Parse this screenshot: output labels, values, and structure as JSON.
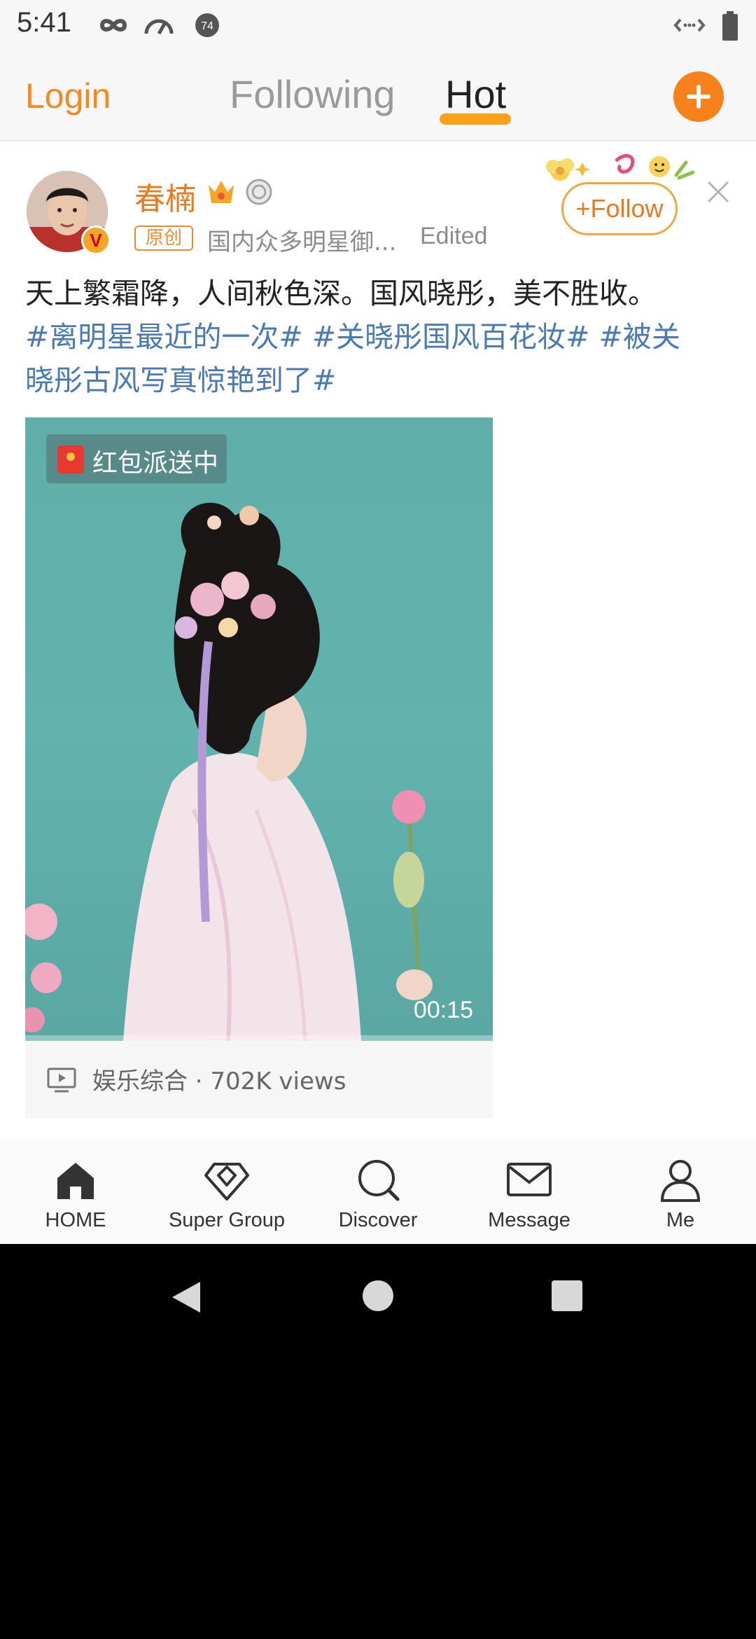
{
  "status_bar": {
    "time": "5:41"
  },
  "top_nav": {
    "login_label": "Login",
    "tabs": [
      {
        "label": "Following",
        "active": false
      },
      {
        "label": "Hot",
        "active": true
      }
    ],
    "accent_color": "#f7821b"
  },
  "post": {
    "author_name": "春楠",
    "original_badge": "原创",
    "source": "国内众多明星御...",
    "edited_label": "Edited",
    "follow_label": "Follow",
    "text_plain": "天上繁霜降，人间秋色深。国风晓彤，美不胜收。",
    "tags_line1": "#离明星最近的一次# #关晓彤国风百花妆# #被关",
    "tags_line2": "晓彤古风写真惊艳到了#",
    "video": {
      "redpacket_label": "红包派送中",
      "duration": "00:15",
      "footer": "娱乐综合 · 702K views"
    }
  },
  "bottom_nav": {
    "items": [
      {
        "label": "HOME",
        "icon": "home-icon"
      },
      {
        "label": "Super Group",
        "icon": "diamond-icon"
      },
      {
        "label": "Discover",
        "icon": "search-icon"
      },
      {
        "label": "Message",
        "icon": "mail-icon"
      },
      {
        "label": "Me",
        "icon": "person-icon"
      }
    ]
  }
}
